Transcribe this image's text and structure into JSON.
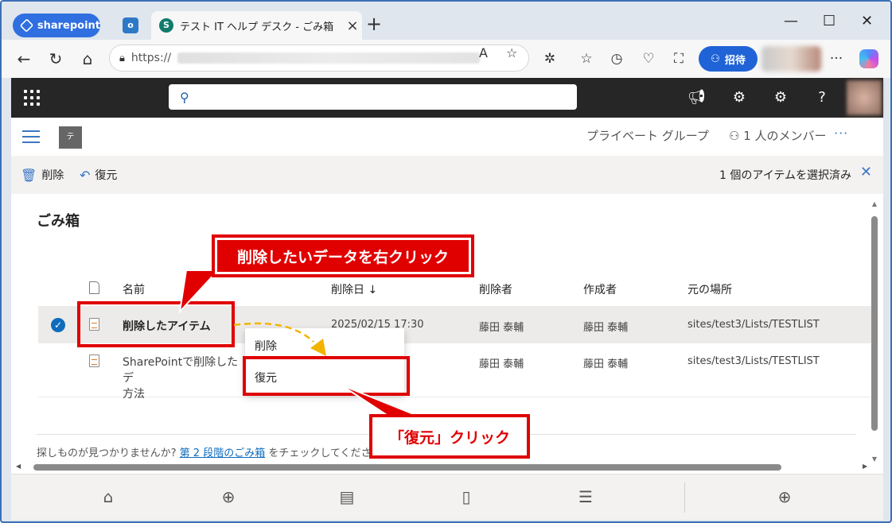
{
  "browser": {
    "workspace_label": "sharepoint",
    "tab_title": "テスト IT ヘルプ デスク - ごみ箱",
    "url_prefix": "https://",
    "invite_label": "招待"
  },
  "site": {
    "logo_text": "テ",
    "privacy_label": "プライベート グループ",
    "members_label": "1 人のメンバー"
  },
  "commandbar": {
    "delete_label": "削除",
    "restore_label": "復元",
    "selection_status": "1 個のアイテムを選択済み"
  },
  "page": {
    "title": "ごみ箱"
  },
  "table": {
    "columns": {
      "name": "名前",
      "deleted_date": "削除日 ↓",
      "deleted_by": "削除者",
      "created_by": "作成者",
      "location": "元の場所"
    },
    "rows": [
      {
        "name": "削除したアイテム",
        "deleted_date": "2025/02/15 17:30",
        "deleted_by": "藤田 泰輔",
        "created_by": "藤田 泰輔",
        "location": "sites/test3/Lists/TESTLIST",
        "selected": true
      },
      {
        "name": "SharePointで削除したデ",
        "name_line2": "方法",
        "deleted_date": "",
        "deleted_by": "藤田 泰輔",
        "created_by": "藤田 泰輔",
        "location": "sites/test3/Lists/TESTLIST",
        "selected": false
      }
    ]
  },
  "hint": {
    "prefix": "探しものが見つかりませんか? ",
    "link": "第 2 段階のごみ箱",
    "suffix": " をチェックしてくださ"
  },
  "context_menu": {
    "delete": "削除",
    "restore": "復元"
  },
  "annotations": {
    "callout_right_click": "削除したいデータを右クリック",
    "callout_restore": "「復元」クリック"
  },
  "colors": {
    "annotation_red": "#e00000",
    "accent_blue": "#0f6cbd",
    "suite_bar": "#262626"
  }
}
